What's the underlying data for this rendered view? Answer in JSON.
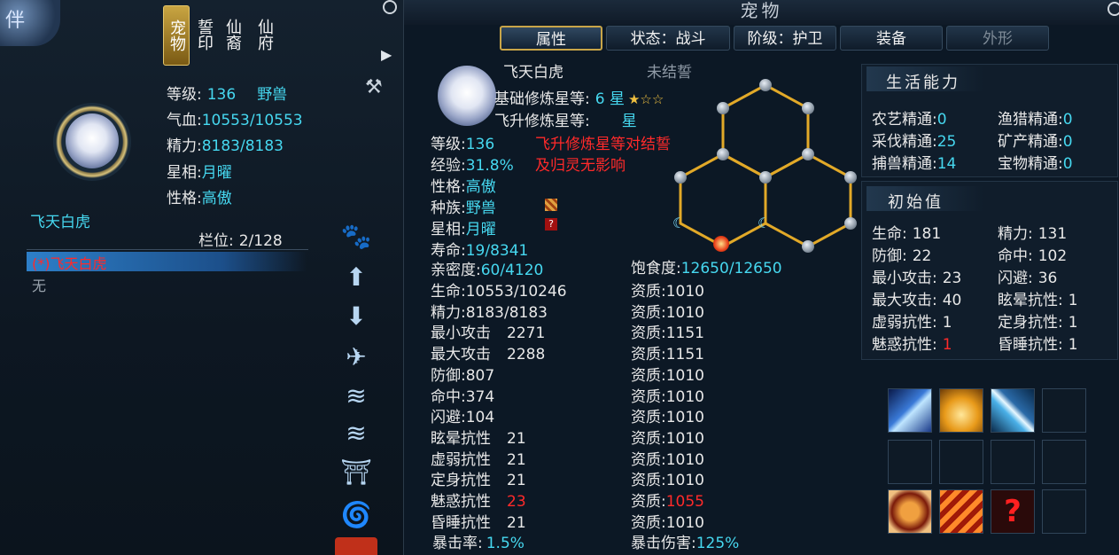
{
  "left": {
    "logo_text": "伴",
    "tabs": [
      "宠物",
      "誓印",
      "仙裔",
      "仙府"
    ],
    "pet": {
      "level_label": "等级:",
      "level_value": "136",
      "type": "野兽",
      "hp_label": "气血:",
      "hp_value": "10553/10553",
      "energy_label": "精力:",
      "energy_value": "8183/8183",
      "star_label": "星相:",
      "star_value": "月曜",
      "nature_label": "性格:",
      "nature_value": "高傲",
      "name": "飞天白虎"
    },
    "slot_label": "栏位:",
    "slot_value": "2/128",
    "list": [
      {
        "text": "(*)飞天白虎"
      },
      {
        "text": "无"
      }
    ],
    "side_icons": [
      "feed-icon",
      "move-up-icon",
      "move-down-icon",
      "release-icon",
      "train-icon",
      "combine-icon",
      "pagoda-icon",
      "swirl-icon",
      "fire-icon"
    ]
  },
  "right": {
    "title": "宠物",
    "tabs": [
      {
        "label": "属性"
      },
      {
        "label": "状态：战斗"
      },
      {
        "label": "阶级：护卫"
      },
      {
        "label": "装备"
      },
      {
        "label": "外形"
      }
    ],
    "pet_name": "飞天白虎",
    "pledge_status": "未结誓",
    "base_star_label": "基础修炼星等:",
    "base_star_value": "6 星",
    "ascend_star_label": "飞升修炼星等:",
    "ascend_star_value": "星",
    "note_line1": "飞升修炼星等对结誓",
    "note_line2": "及归灵无影响",
    "basic": [
      {
        "label": "等级:",
        "value": "136"
      },
      {
        "label": "经验:",
        "value": "31.8%"
      },
      {
        "label": "性格:",
        "value": "高傲"
      },
      {
        "label": "种族:",
        "value": "野兽"
      },
      {
        "label": "星相:",
        "value": "月曜"
      },
      {
        "label": "寿命:",
        "value": "19/8341"
      },
      {
        "label": "亲密度:",
        "value": "60/4120"
      }
    ],
    "satiety_label": "饱食度:",
    "satiety_value": "12650/12650",
    "stats": [
      {
        "label": "生命:",
        "value": "10553/10246",
        "apt_label": "资质:",
        "apt": "1010"
      },
      {
        "label": "精力:",
        "value": "8183/8183",
        "apt_label": "资质:",
        "apt": "1010"
      },
      {
        "label": "最小攻击",
        "value": "2271",
        "apt_label": "资质:",
        "apt": "1151"
      },
      {
        "label": "最大攻击",
        "value": "2288",
        "apt_label": "资质:",
        "apt": "1151"
      },
      {
        "label": "防御:",
        "value": "807",
        "apt_label": "资质:",
        "apt": "1010"
      },
      {
        "label": "命中:",
        "value": "374",
        "apt_label": "资质:",
        "apt": "1010"
      },
      {
        "label": "闪避:",
        "value": "104",
        "apt_label": "资质:",
        "apt": "1010"
      },
      {
        "label": "眩晕抗性",
        "value": "21",
        "apt_label": "资质:",
        "apt": "1010"
      },
      {
        "label": "虚弱抗性",
        "value": "21",
        "apt_label": "资质:",
        "apt": "1010"
      },
      {
        "label": "定身抗性",
        "value": "21",
        "apt_label": "资质:",
        "apt": "1010"
      },
      {
        "label": "魅惑抗性",
        "value": "23",
        "apt_label": "资质:",
        "apt": "1055"
      },
      {
        "label": "昏睡抗性",
        "value": "21",
        "apt_label": "资质:",
        "apt": "1010"
      }
    ],
    "crit_rate_label": "暴击率:",
    "crit_rate_value": "1.5%",
    "crit_dmg_label": "暴击伤害:",
    "crit_dmg_value": "125%",
    "life_skills_title": "生活能力",
    "life_skills": [
      {
        "label": "农艺精通:",
        "value": "0"
      },
      {
        "label": "渔猎精通:",
        "value": "0"
      },
      {
        "label": "采伐精通:",
        "value": "25"
      },
      {
        "label": "矿产精通:",
        "value": "0"
      },
      {
        "label": "捕兽精通:",
        "value": "14"
      },
      {
        "label": "宝物精通:",
        "value": "0"
      }
    ],
    "initial_title": "初始值",
    "initial": [
      {
        "label": "生命:",
        "value": "181"
      },
      {
        "label": "精力:",
        "value": "131"
      },
      {
        "label": "防御:",
        "value": "22"
      },
      {
        "label": "命中:",
        "value": "102"
      },
      {
        "label": "最小攻击:",
        "value": "23"
      },
      {
        "label": "闪避:",
        "value": "36"
      },
      {
        "label": "最大攻击:",
        "value": "40"
      },
      {
        "label": "眩晕抗性:",
        "value": "1"
      },
      {
        "label": "虚弱抗性:",
        "value": "1"
      },
      {
        "label": "定身抗性:",
        "value": "1"
      },
      {
        "label": "魅惑抗性:",
        "value": "1"
      },
      {
        "label": "昏睡抗性:",
        "value": "1"
      }
    ],
    "skill_unknown_glyph": "?"
  }
}
